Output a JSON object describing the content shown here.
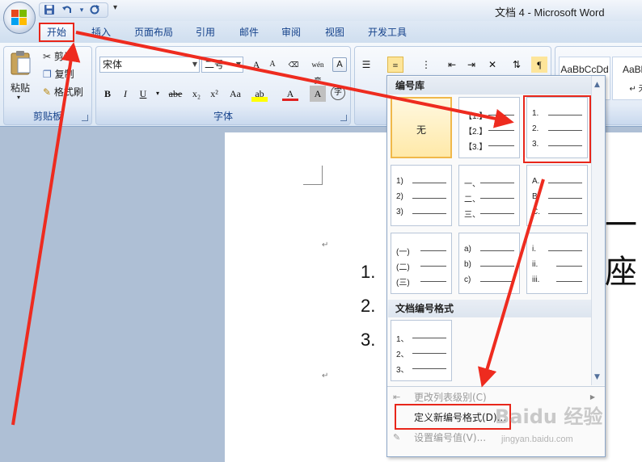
{
  "window": {
    "title": "文档 4 - Microsoft Word"
  },
  "quick_access": {
    "icons": [
      "save-icon",
      "undo-icon",
      "redo-icon"
    ],
    "more": "▾"
  },
  "tabs": [
    {
      "label": "开始"
    },
    {
      "label": "插入"
    },
    {
      "label": "页面布局"
    },
    {
      "label": "引用"
    },
    {
      "label": "邮件"
    },
    {
      "label": "审阅"
    },
    {
      "label": "视图"
    },
    {
      "label": "开发工具"
    }
  ],
  "clipboard": {
    "label": "剪贴板",
    "paste": "粘贴",
    "cut": "剪切",
    "copy": "复制",
    "format_painter": "格式刷"
  },
  "font": {
    "label": "字体",
    "name": "宋体",
    "size": "二号",
    "bold": "B",
    "italic": "I",
    "underline": "U",
    "strike": "abe",
    "sub": "x₂",
    "sup": "x²",
    "case": "Aa",
    "highlight": "ab",
    "color": "A",
    "shade": "A",
    "enclose": "字",
    "grow": "A",
    "shrink": "A",
    "phonetic": "wén 变",
    "border": "A"
  },
  "styles": {
    "preview1": "AaBbCcDd",
    "preview2": "AaBbC",
    "preview2_sub": "↵ 无"
  },
  "numbering_panel": {
    "library_header": "编号库",
    "none_label": "无",
    "doc_header": "文档编号格式",
    "library": [
      {
        "labels": []
      },
      {
        "labels": [
          "【1.】",
          "【2.】",
          "【3.】"
        ]
      },
      {
        "labels": [
          "1.",
          "2.",
          "3."
        ]
      },
      {
        "labels": [
          "1)",
          "2)",
          "3)"
        ]
      },
      {
        "labels": [
          "一、",
          "二、",
          "三、"
        ]
      },
      {
        "labels": [
          "A.",
          "B.",
          "C."
        ]
      },
      {
        "labels": [
          "(一)",
          "(二)",
          "(三)"
        ]
      },
      {
        "labels": [
          "a)",
          "b)",
          "c)"
        ]
      },
      {
        "labels": [
          "i.",
          "ii.",
          "iii."
        ]
      }
    ],
    "doc_formats": [
      {
        "labels": [
          "1、",
          "2、",
          "3、"
        ]
      }
    ],
    "menu": {
      "change_level": "更改列表级别(C)",
      "define_new": "定义新编号格式(D)...",
      "set_value": "设置编号值(V)..."
    }
  },
  "document": {
    "list": [
      "1.",
      "2.",
      "3."
    ],
    "heading_fragment": "一座"
  },
  "watermark": {
    "logo": "Baidu 经验",
    "url": "jingyan.baidu.com"
  }
}
